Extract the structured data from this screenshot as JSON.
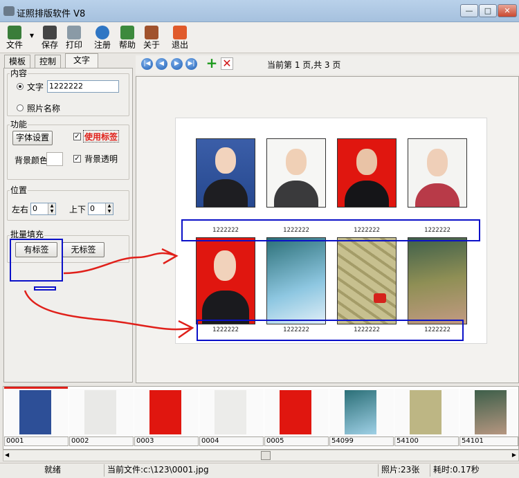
{
  "window": {
    "title": "证照排版软件 V8"
  },
  "toolbar": {
    "items": [
      {
        "label": "文件",
        "icon": "file-icon",
        "color": "#3a7d3a"
      },
      {
        "label": "保存",
        "icon": "save-icon",
        "color": "#444444"
      },
      {
        "label": "打印",
        "icon": "print-icon",
        "color": "#8a9aa6"
      },
      {
        "label": "注册",
        "icon": "register-icon",
        "color": "#2f76c4"
      },
      {
        "label": "帮助",
        "icon": "help-icon",
        "color": "#3d8a3d"
      },
      {
        "label": "关于",
        "icon": "about-icon",
        "color": "#a0522d"
      },
      {
        "label": "退出",
        "icon": "exit-icon",
        "color": "#e05a2b"
      }
    ]
  },
  "tabs": [
    "模板",
    "控制",
    "文字"
  ],
  "content_group": {
    "title": "内容",
    "text_option": "文字",
    "text_value": "1222222",
    "photo_name_option": "照片名称"
  },
  "function_group": {
    "title": "功能",
    "font_button": "字体设置",
    "use_label": "使用标签",
    "bg_color_label": "背景颜色",
    "bg_transparent": "背景透明"
  },
  "position_group": {
    "title": "位置",
    "lr_label": "左右",
    "lr_value": "0",
    "ud_label": "上下",
    "ud_value": "0"
  },
  "batch_group": {
    "title": "批量填充",
    "with_label_button": "有标签",
    "without_label_button": "无标签"
  },
  "nav": {
    "page_info": "当前第 1 页,共 3 页",
    "icons": [
      "first-page-icon",
      "prev-page-icon",
      "next-page-icon",
      "last-page-icon"
    ],
    "add_icon": "plus-icon",
    "delete_icon": "x-icon"
  },
  "sheet": {
    "captions": [
      "1222222",
      "1222222",
      "1222222",
      "1222222",
      "1222222",
      "1222222",
      "1222222",
      "1222222"
    ]
  },
  "thumbnails": [
    "0001",
    "0002",
    "0003",
    "0004",
    "0005",
    "54099",
    "54100",
    "54101"
  ],
  "status": {
    "ready": "就绪",
    "current_file": "当前文件:c:\\123\\0001.jpg",
    "photo_count": "照片:23张",
    "time": "耗时:0.17秒"
  },
  "colors": {
    "annotation_blue": "#0a10c8",
    "annotation_red": "#e0201a",
    "label_red": "#e0201a"
  }
}
